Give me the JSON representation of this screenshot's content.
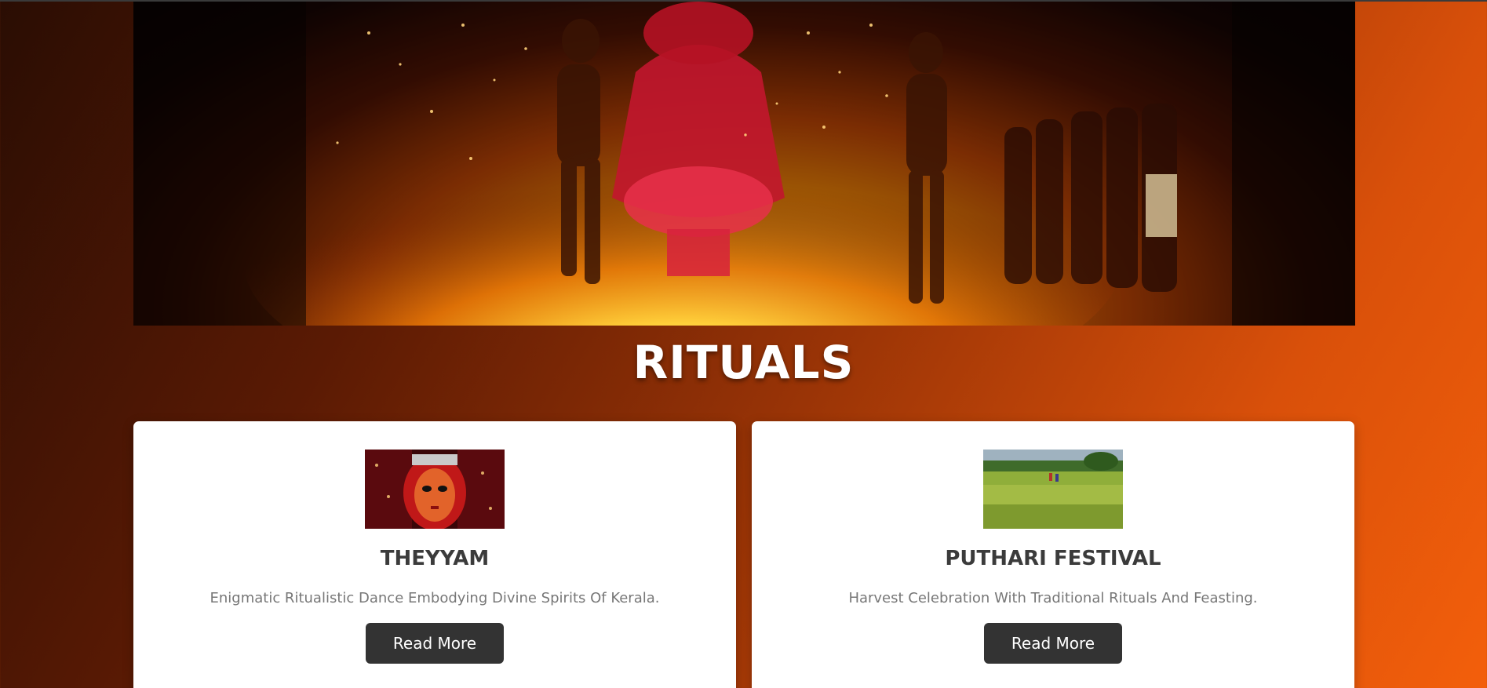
{
  "page": {
    "heading": "RITUALS"
  },
  "hero": {
    "image_icon": "fire-ritual-photo"
  },
  "cards": [
    {
      "image_icon": "theyyam-face-photo",
      "title": "THEYYAM",
      "description": "Enigmatic Ritualistic Dance Embodying Divine Spirits Of Kerala.",
      "button_label": "Read More"
    },
    {
      "image_icon": "paddy-field-photo",
      "title": "PUTHARI FESTIVAL",
      "description": "Harvest Celebration With Traditional Rituals And Feasting.",
      "button_label": "Read More"
    }
  ],
  "colors": {
    "card_bg": "#ffffff",
    "button_bg": "#333333",
    "heading": "#ffffff",
    "card_title": "#3b3b3b",
    "card_text": "#777777"
  }
}
